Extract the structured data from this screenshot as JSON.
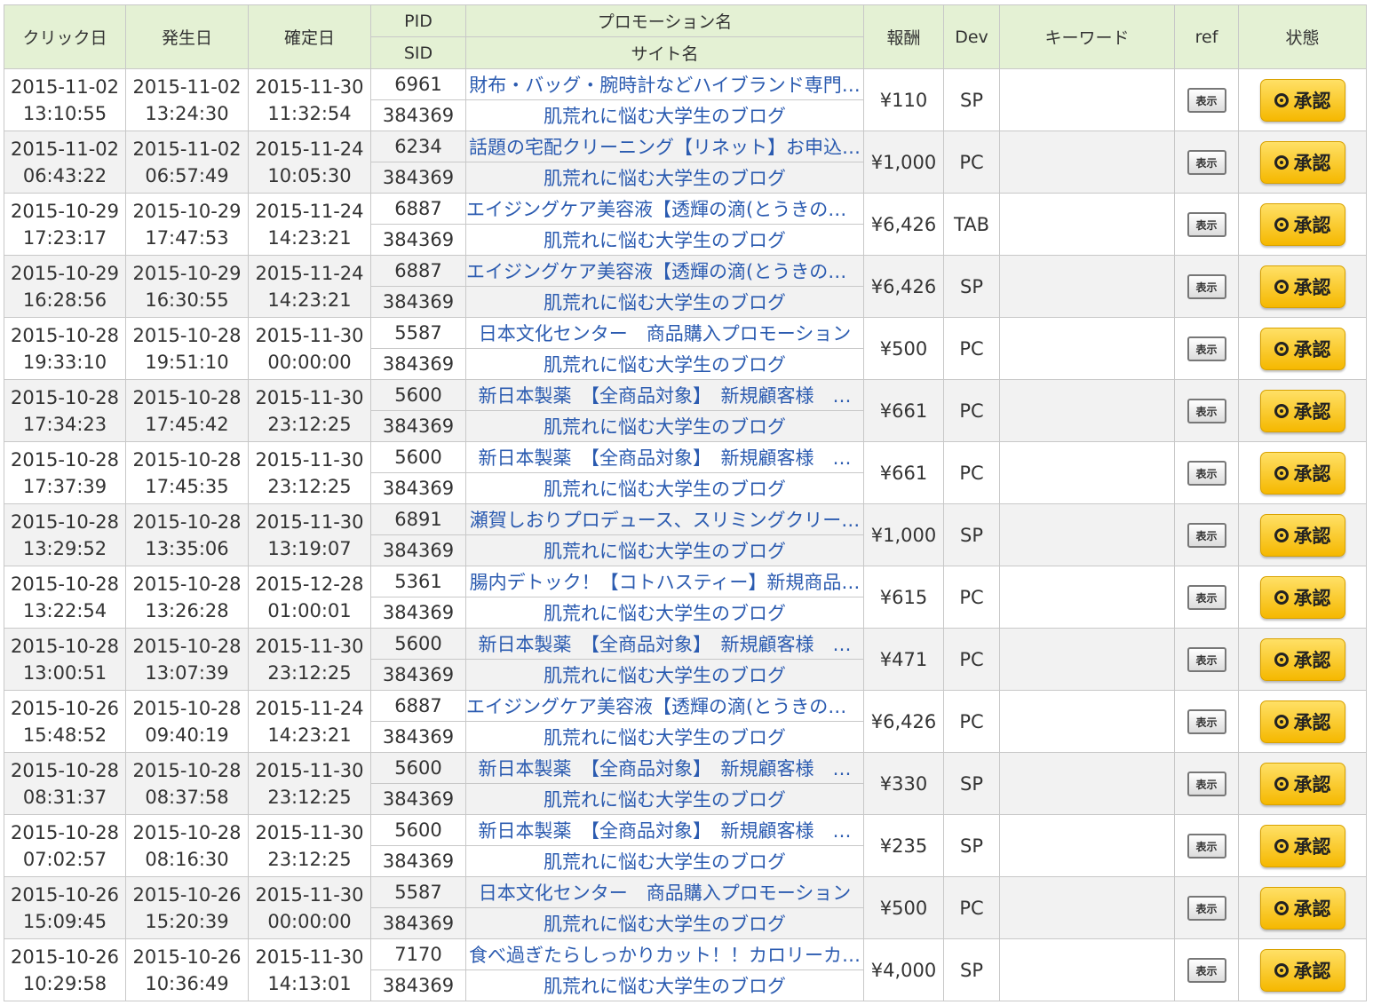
{
  "headers": {
    "click_date": "クリック日",
    "occur_date": "発生日",
    "confirm_date": "確定日",
    "pid": "PID",
    "sid": "SID",
    "promotion": "プロモーション名",
    "site": "サイト名",
    "reward": "報酬",
    "device": "Dev",
    "keyword": "キーワード",
    "ref": "ref",
    "status": "状態"
  },
  "ref_button_label": "表示",
  "status_label": "承認",
  "colors": {
    "header_bg": "#e4f1d4",
    "link": "#2b5bb0",
    "status_button": "#f5b800"
  },
  "rows": [
    {
      "click_date": "2015-11-02",
      "click_time": "13:10:55",
      "occur_date": "2015-11-02",
      "occur_time": "13:24:30",
      "confirm_date": "2015-11-30",
      "confirm_time": "11:32:54",
      "pid": "6961",
      "sid": "384369",
      "promotion": "財布・バッグ・腕時計などハイブランド専門…",
      "site": "肌荒れに悩む大学生のブログ",
      "reward": "¥110",
      "device": "SP",
      "keyword": ""
    },
    {
      "click_date": "2015-11-02",
      "click_time": "06:43:22",
      "occur_date": "2015-11-02",
      "occur_time": "06:57:49",
      "confirm_date": "2015-11-24",
      "confirm_time": "10:05:30",
      "pid": "6234",
      "sid": "384369",
      "promotion": "話題の宅配クリーニング【リネット】お申込…",
      "site": "肌荒れに悩む大学生のブログ",
      "reward": "¥1,000",
      "device": "PC",
      "keyword": ""
    },
    {
      "click_date": "2015-10-29",
      "click_time": "17:23:17",
      "occur_date": "2015-10-29",
      "occur_time": "17:47:53",
      "confirm_date": "2015-11-24",
      "confirm_time": "14:23:21",
      "pid": "6887",
      "sid": "384369",
      "promotion": "エイジングケア美容液【透輝の滴(とうきのし…",
      "site": "肌荒れに悩む大学生のブログ",
      "reward": "¥6,426",
      "device": "TAB",
      "keyword": ""
    },
    {
      "click_date": "2015-10-29",
      "click_time": "16:28:56",
      "occur_date": "2015-10-29",
      "occur_time": "16:30:55",
      "confirm_date": "2015-11-24",
      "confirm_time": "14:23:21",
      "pid": "6887",
      "sid": "384369",
      "promotion": "エイジングケア美容液【透輝の滴(とうきのし…",
      "site": "肌荒れに悩む大学生のブログ",
      "reward": "¥6,426",
      "device": "SP",
      "keyword": ""
    },
    {
      "click_date": "2015-10-28",
      "click_time": "19:33:10",
      "occur_date": "2015-10-28",
      "occur_time": "19:51:10",
      "confirm_date": "2015-11-30",
      "confirm_time": "00:00:00",
      "pid": "5587",
      "sid": "384369",
      "promotion": "日本文化センター　商品購入プロモーション",
      "site": "肌荒れに悩む大学生のブログ",
      "reward": "¥500",
      "device": "PC",
      "keyword": ""
    },
    {
      "click_date": "2015-10-28",
      "click_time": "17:34:23",
      "occur_date": "2015-10-28",
      "occur_time": "17:45:42",
      "confirm_date": "2015-11-30",
      "confirm_time": "23:12:25",
      "pid": "5600",
      "sid": "384369",
      "promotion": "新日本製薬　【全商品対象】　新規顧客様　…",
      "site": "肌荒れに悩む大学生のブログ",
      "reward": "¥661",
      "device": "PC",
      "keyword": ""
    },
    {
      "click_date": "2015-10-28",
      "click_time": "17:37:39",
      "occur_date": "2015-10-28",
      "occur_time": "17:45:35",
      "confirm_date": "2015-11-30",
      "confirm_time": "23:12:25",
      "pid": "5600",
      "sid": "384369",
      "promotion": "新日本製薬　【全商品対象】　新規顧客様　…",
      "site": "肌荒れに悩む大学生のブログ",
      "reward": "¥661",
      "device": "PC",
      "keyword": ""
    },
    {
      "click_date": "2015-10-28",
      "click_time": "13:29:52",
      "occur_date": "2015-10-28",
      "occur_time": "13:35:06",
      "confirm_date": "2015-11-30",
      "confirm_time": "13:19:07",
      "pid": "6891",
      "sid": "384369",
      "promotion": "瀬賀しおりプロデュース、スリミングクリー…",
      "site": "肌荒れに悩む大学生のブログ",
      "reward": "¥1,000",
      "device": "SP",
      "keyword": ""
    },
    {
      "click_date": "2015-10-28",
      "click_time": "13:22:54",
      "occur_date": "2015-10-28",
      "occur_time": "13:26:28",
      "confirm_date": "2015-12-28",
      "confirm_time": "01:00:01",
      "pid": "5361",
      "sid": "384369",
      "promotion": "腸内デトック！【コトハスティー】新規商品…",
      "site": "肌荒れに悩む大学生のブログ",
      "reward": "¥615",
      "device": "PC",
      "keyword": ""
    },
    {
      "click_date": "2015-10-28",
      "click_time": "13:00:51",
      "occur_date": "2015-10-28",
      "occur_time": "13:07:39",
      "confirm_date": "2015-11-30",
      "confirm_time": "23:12:25",
      "pid": "5600",
      "sid": "384369",
      "promotion": "新日本製薬　【全商品対象】　新規顧客様　…",
      "site": "肌荒れに悩む大学生のブログ",
      "reward": "¥471",
      "device": "PC",
      "keyword": ""
    },
    {
      "click_date": "2015-10-26",
      "click_time": "15:48:52",
      "occur_date": "2015-10-28",
      "occur_time": "09:40:19",
      "confirm_date": "2015-11-24",
      "confirm_time": "14:23:21",
      "pid": "6887",
      "sid": "384369",
      "promotion": "エイジングケア美容液【透輝の滴(とうきのし…",
      "site": "肌荒れに悩む大学生のブログ",
      "reward": "¥6,426",
      "device": "PC",
      "keyword": ""
    },
    {
      "click_date": "2015-10-28",
      "click_time": "08:31:37",
      "occur_date": "2015-10-28",
      "occur_time": "08:37:58",
      "confirm_date": "2015-11-30",
      "confirm_time": "23:12:25",
      "pid": "5600",
      "sid": "384369",
      "promotion": "新日本製薬　【全商品対象】　新規顧客様　…",
      "site": "肌荒れに悩む大学生のブログ",
      "reward": "¥330",
      "device": "SP",
      "keyword": ""
    },
    {
      "click_date": "2015-10-28",
      "click_time": "07:02:57",
      "occur_date": "2015-10-28",
      "occur_time": "08:16:30",
      "confirm_date": "2015-11-30",
      "confirm_time": "23:12:25",
      "pid": "5600",
      "sid": "384369",
      "promotion": "新日本製薬　【全商品対象】　新規顧客様　…",
      "site": "肌荒れに悩む大学生のブログ",
      "reward": "¥235",
      "device": "SP",
      "keyword": ""
    },
    {
      "click_date": "2015-10-26",
      "click_time": "15:09:45",
      "occur_date": "2015-10-26",
      "occur_time": "15:20:39",
      "confirm_date": "2015-11-30",
      "confirm_time": "00:00:00",
      "pid": "5587",
      "sid": "384369",
      "promotion": "日本文化センター　商品購入プロモーション",
      "site": "肌荒れに悩む大学生のブログ",
      "reward": "¥500",
      "device": "PC",
      "keyword": ""
    },
    {
      "click_date": "2015-10-26",
      "click_time": "10:29:58",
      "occur_date": "2015-10-26",
      "occur_time": "10:36:49",
      "confirm_date": "2015-11-30",
      "confirm_time": "14:13:01",
      "pid": "7170",
      "sid": "384369",
      "promotion": "食べ過ぎたらしっかりカット！！カロリーカ…",
      "site": "肌荒れに悩む大学生のブログ",
      "reward": "¥4,000",
      "device": "SP",
      "keyword": ""
    }
  ]
}
